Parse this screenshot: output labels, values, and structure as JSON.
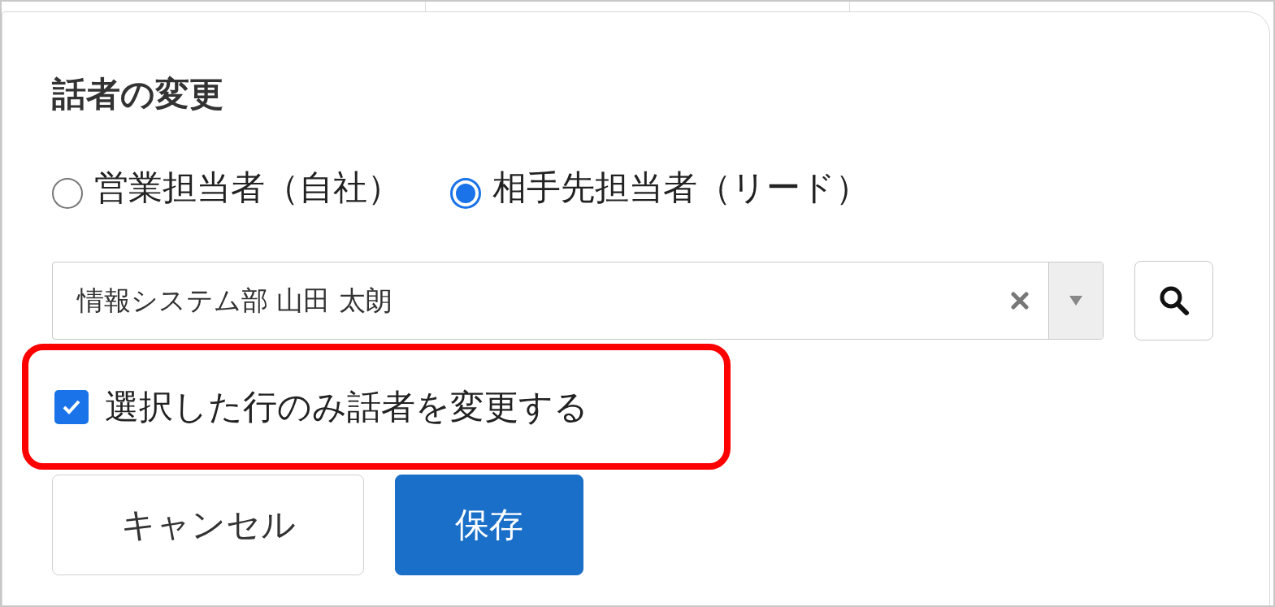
{
  "dialog": {
    "title": "話者の変更",
    "speaker_options": [
      {
        "label": "営業担当者（自社）",
        "selected": false
      },
      {
        "label": "相手先担当者（リード）",
        "selected": true
      }
    ],
    "speaker_field": {
      "value": "情報システム部 山田 太朗"
    },
    "only_selected_rows": {
      "label": "選択した行のみ話者を変更する",
      "checked": true
    },
    "buttons": [
      {
        "label": "キャンセル",
        "kind": "secondary"
      },
      {
        "label": "保存",
        "kind": "primary"
      }
    ]
  }
}
